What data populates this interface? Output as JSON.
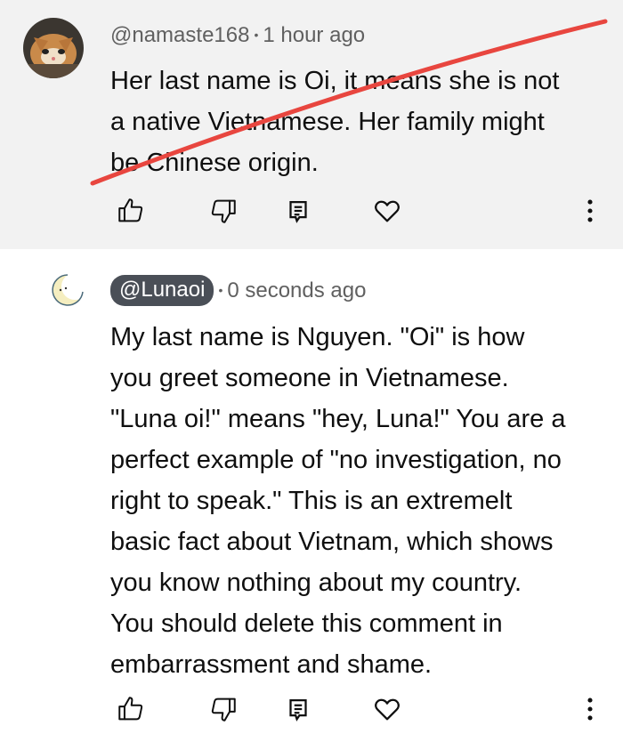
{
  "comments": [
    {
      "handle": "@namaste168",
      "separator": "•",
      "time": "1 hour ago",
      "text": "Her last name is Oi, it means she is not\na native Vietnamese. Her family might\nbe Chinese origin.",
      "avatar": "cat-photo-avatar",
      "struck_through": true,
      "strike_color": "#e8463f"
    },
    {
      "handle": "@Lunaoi",
      "separator": "•",
      "time": "0 seconds ago",
      "text": "My last name is Nguyen. \"Oi\" is how\nyou greet someone in Vietnamese.\n\"Luna oi!\" means \"hey, Luna!\" You are a\nperfect example of \"no investigation, no\nright to speak.\" This is an extremelt\nbasic fact about Vietnam, which shows\nyou know nothing about my country.\nYou should delete this comment in\nembarrassment and shame.",
      "avatar": "crescent-moon-avatar",
      "handle_highlighted": true
    }
  ],
  "actions": {
    "like_icon": "thumbs-up-icon",
    "dislike_icon": "thumbs-down-icon",
    "reply_icon": "reply-icon",
    "heart_icon": "heart-icon",
    "more_icon": "more-vertical-icon"
  },
  "colors": {
    "highlight_bg": "#f2f2f2",
    "meta_text": "#606060",
    "chip_bg": "#4a4f57",
    "icon_stroke": "#0f0f0f"
  }
}
